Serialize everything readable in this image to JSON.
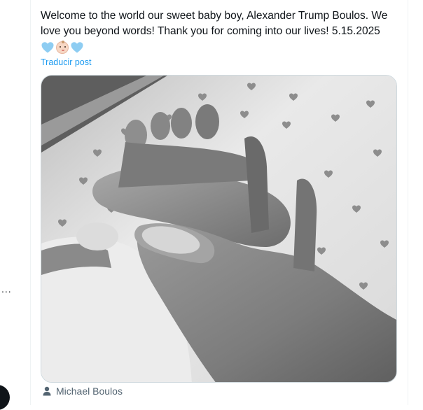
{
  "post": {
    "text": "Welcome to the world our sweet baby boy, Alexander Trump Boulos. We love you beyond words! Thank you for coming into our lives! 5.15.2025",
    "emojis": [
      "blue-heart-icon",
      "baby-icon",
      "blue-heart-icon"
    ],
    "translate_label": "Traducir post"
  },
  "media": {
    "alt_icon": "photo"
  },
  "credit": {
    "icon": "person-icon",
    "name": "Michael Boulos"
  },
  "left_rail": {
    "more_label": "..."
  },
  "colors": {
    "text": "#0f1419",
    "link": "#1d9bf0",
    "muted": "#536471",
    "heart": "#8ecdf2",
    "border": "#cfd9de"
  }
}
